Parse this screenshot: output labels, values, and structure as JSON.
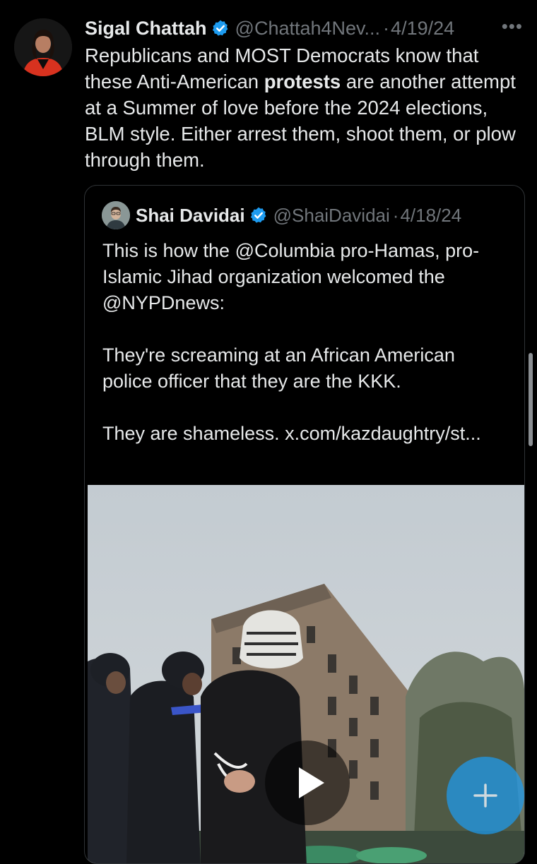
{
  "tweet": {
    "author_name": "Sigal Chattah",
    "handle": "@Chattah4Nev...",
    "separator": "·",
    "date": "4/19/24",
    "more_label": "•••",
    "text_before": "Republicans and MOST Democrats know that these Anti-American ",
    "text_bold": "protests",
    "text_after": " are another attempt at a Summer of love before the 2024 elections, BLM style. Either arrest them, shoot them, or plow through them."
  },
  "quote": {
    "author_name": "Shai Davidai",
    "handle": "@ShaiDavidai",
    "separator": "·",
    "date": "4/18/24",
    "text": "This is how the @Columbia pro-Hamas, pro-Islamic Jihad organization welcomed the @NYPDnews:\n\nThey're screaming at an African American police officer that they are the KKK.\n\nThey are shameless. x.com/kazdaughtry/st..."
  },
  "icons": {
    "verified": "verified-badge-icon",
    "more": "more-options-icon",
    "play": "play-icon",
    "compose": "plus-icon"
  },
  "colors": {
    "background": "#000000",
    "text": "#e7e9ea",
    "secondary": "#71767b",
    "accent": "#1d9bf0",
    "border": "#2f3336"
  }
}
